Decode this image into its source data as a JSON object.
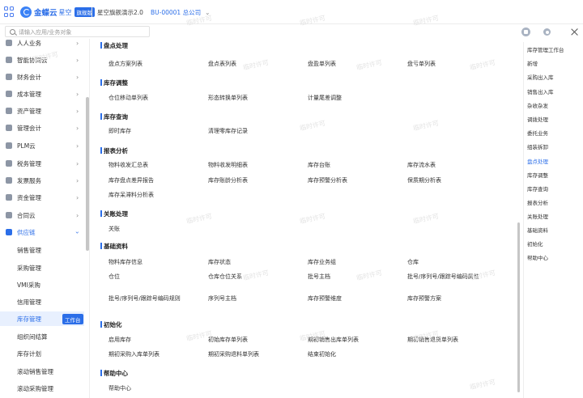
{
  "header": {
    "logo_text": "金蝶云",
    "logo_sub": "星空",
    "logo_badge": "旗舰版",
    "app_name": "星空旗舰演示2.0",
    "org": "BU-00001 总公司",
    "org_chevron": "⌄"
  },
  "search": {
    "placeholder": "请输入应用/业务对象"
  },
  "sidebar": {
    "items": [
      {
        "label": "人人业务",
        "arrow": "›"
      },
      {
        "label": "智能协同云",
        "arrow": "›"
      },
      {
        "label": "财务会计",
        "arrow": "›"
      },
      {
        "label": "成本管理",
        "arrow": "›"
      },
      {
        "label": "资产管理",
        "arrow": "›"
      },
      {
        "label": "管理会计",
        "arrow": "›"
      },
      {
        "label": "PLM云",
        "arrow": "›"
      },
      {
        "label": "税务管理",
        "arrow": "›"
      },
      {
        "label": "发票服务",
        "arrow": "›"
      },
      {
        "label": "资金管理",
        "arrow": "›"
      },
      {
        "label": "合同云",
        "arrow": "›"
      },
      {
        "label": "供应链",
        "arrow": "›"
      }
    ],
    "subitems": [
      {
        "label": "销售管理"
      },
      {
        "label": "采购管理"
      },
      {
        "label": "VMI采购"
      },
      {
        "label": "信用管理"
      },
      {
        "label": "库存管理",
        "tag": "工作台"
      },
      {
        "label": "组织间结算"
      },
      {
        "label": "库存计划"
      },
      {
        "label": "滚动销售管理"
      },
      {
        "label": "滚动采购管理"
      }
    ]
  },
  "main": {
    "sections": [
      {
        "title": "盘点处理",
        "links": [
          "盘点方案列表",
          "盘点表列表",
          "盘盈单列表",
          "盘亏单列表"
        ]
      },
      {
        "title": "库存调整",
        "links": [
          "仓位移动单列表",
          "形态转换单列表",
          "计量尾差调整"
        ]
      },
      {
        "title": "库存查询",
        "links": [
          "即时库存",
          "清理零库存记录"
        ]
      },
      {
        "title": "报表分析",
        "links": [
          "物料收发汇总表",
          "物料收发明细表",
          "库存台账",
          "库存流水表",
          "库存盘点差异报告",
          "库存账龄分析表",
          "库存预警分析表",
          "保质期分析表",
          "库存呆滞料分析表"
        ]
      },
      {
        "title": "关账处理",
        "links": [
          "关账"
        ]
      },
      {
        "title": "基础资料",
        "links": [
          "物料库存信息",
          "库存状态",
          "库存业务组",
          "仓库",
          "仓位",
          "仓库仓位关系",
          "批号主档",
          "批号/序列号/跟踪号编码属性",
          "批号/序列号/跟踪号编码规则",
          "序列号主档",
          "库存预警维度",
          "库存预警方案"
        ]
      },
      {
        "title": "初始化",
        "links": [
          "启用库存",
          "初始库存单列表",
          "期初销售出库单列表",
          "期初销售退货单列表",
          "期初采购入库单列表",
          "期初采购退料单列表",
          "结束初始化"
        ]
      },
      {
        "title": "帮助中心",
        "links": [
          "帮助中心"
        ]
      }
    ]
  },
  "rightnav": {
    "items": [
      "库存管理工作台",
      "新增",
      "采购出入库",
      "销售出入库",
      "杂收杂发",
      "调拨处理",
      "委托业务",
      "组装拆卸",
      "盘点处理",
      "库存调整",
      "库存查询",
      "报表分析",
      "关账处理",
      "基础资料",
      "初始化",
      "帮助中心"
    ]
  },
  "watermark": "临时许可",
  "colors": {
    "accent": "#2b6ee8",
    "active_bg": "#e8f0fe"
  }
}
